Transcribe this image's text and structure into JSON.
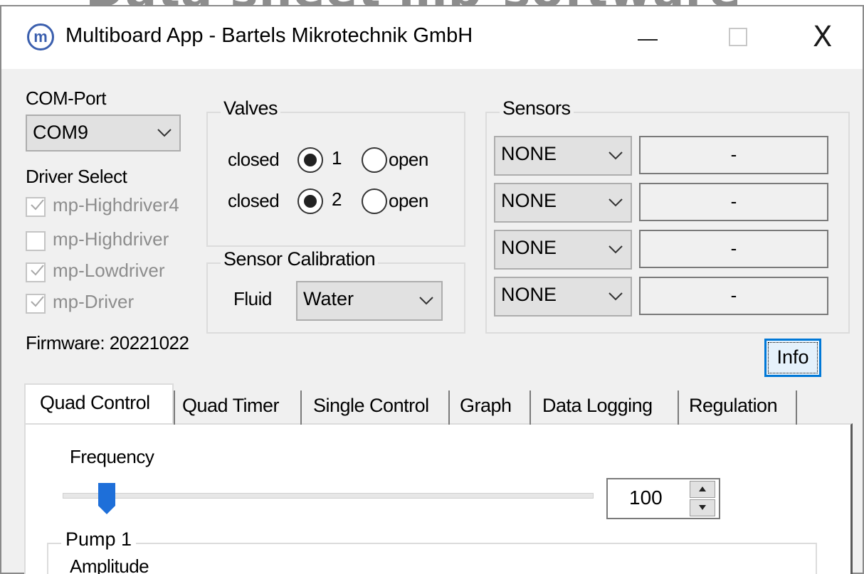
{
  "background_title": "Data sheet mp-software",
  "window": {
    "title": "Multiboard App - Bartels Mikrotechnik GmbH",
    "icon": "multiboard-logo-icon",
    "controls": {
      "minimize": "—",
      "maximize": "□",
      "close": "X"
    }
  },
  "com_port": {
    "label": "COM-Port",
    "value": "COM9"
  },
  "driver_select": {
    "label": "Driver Select",
    "options": [
      {
        "label": "mp-Highdriver4",
        "checked": true
      },
      {
        "label": "mp-Highdriver",
        "checked": false
      },
      {
        "label": "mp-Lowdriver",
        "checked": true
      },
      {
        "label": "mp-Driver",
        "checked": true
      }
    ]
  },
  "firmware": "Firmware: 20221022",
  "valves": {
    "legend": "Valves",
    "rows": [
      {
        "closed_label": "closed",
        "number": "1",
        "open_label": "open",
        "state": "closed"
      },
      {
        "closed_label": "closed",
        "number": "2",
        "open_label": "open",
        "state": "closed"
      }
    ]
  },
  "sensor_calibration": {
    "legend": "Sensor Calibration",
    "fluid_label": "Fluid",
    "fluid_value": "Water"
  },
  "sensors": {
    "legend": "Sensors",
    "rows": [
      {
        "type": "NONE",
        "value": "-"
      },
      {
        "type": "NONE",
        "value": "-"
      },
      {
        "type": "NONE",
        "value": "-"
      },
      {
        "type": "NONE",
        "value": "-"
      }
    ]
  },
  "info_button": "Info",
  "tabs": [
    {
      "label": "Quad Control",
      "active": true
    },
    {
      "label": "Quad Timer",
      "active": false
    },
    {
      "label": "Single Control",
      "active": false
    },
    {
      "label": "Graph",
      "active": false
    },
    {
      "label": "Data Logging",
      "active": false
    },
    {
      "label": "Regulation",
      "active": false
    }
  ],
  "quad_control": {
    "frequency_label": "Frequency",
    "frequency_value": "100",
    "frequency_slider_fraction": 0.07,
    "pump1_legend": "Pump 1",
    "amplitude_label": "Amplitude"
  },
  "colors": {
    "accent": "#0078d7",
    "slider_thumb": "#1e6fd9",
    "disabled_text": "#8d8d8d"
  }
}
